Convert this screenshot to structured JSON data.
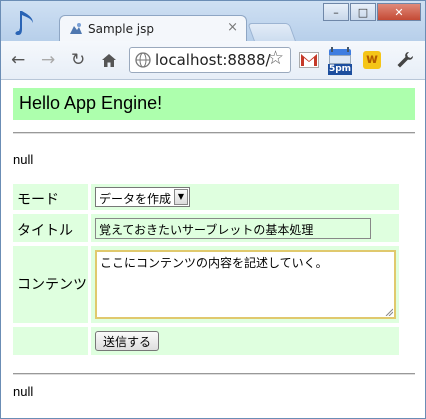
{
  "browser": {
    "tab_title": "Sample jsp",
    "tab_close": "×",
    "url": "localhost:8888/",
    "window_buttons": [
      "–",
      "□",
      "✕"
    ],
    "ext_calendar_label": "5pm",
    "ext_w_label": "w"
  },
  "page": {
    "heading": "Hello App Engine!",
    "null_top": "null",
    "null_bottom": "null",
    "form": {
      "mode_label": "モード",
      "mode_value": "データを作成",
      "title_label": "タイトル",
      "title_value": "覚えておきたいサーブレットの基本処理",
      "contents_label": "コンテンツ",
      "contents_value": "ここにコンテンツの内容を記述していく。",
      "submit_label": "送信する"
    }
  },
  "colors": {
    "heading_bg": "#adffad",
    "form_cell_bg": "#dfffdf",
    "textarea_focus": "#e0c96d"
  }
}
